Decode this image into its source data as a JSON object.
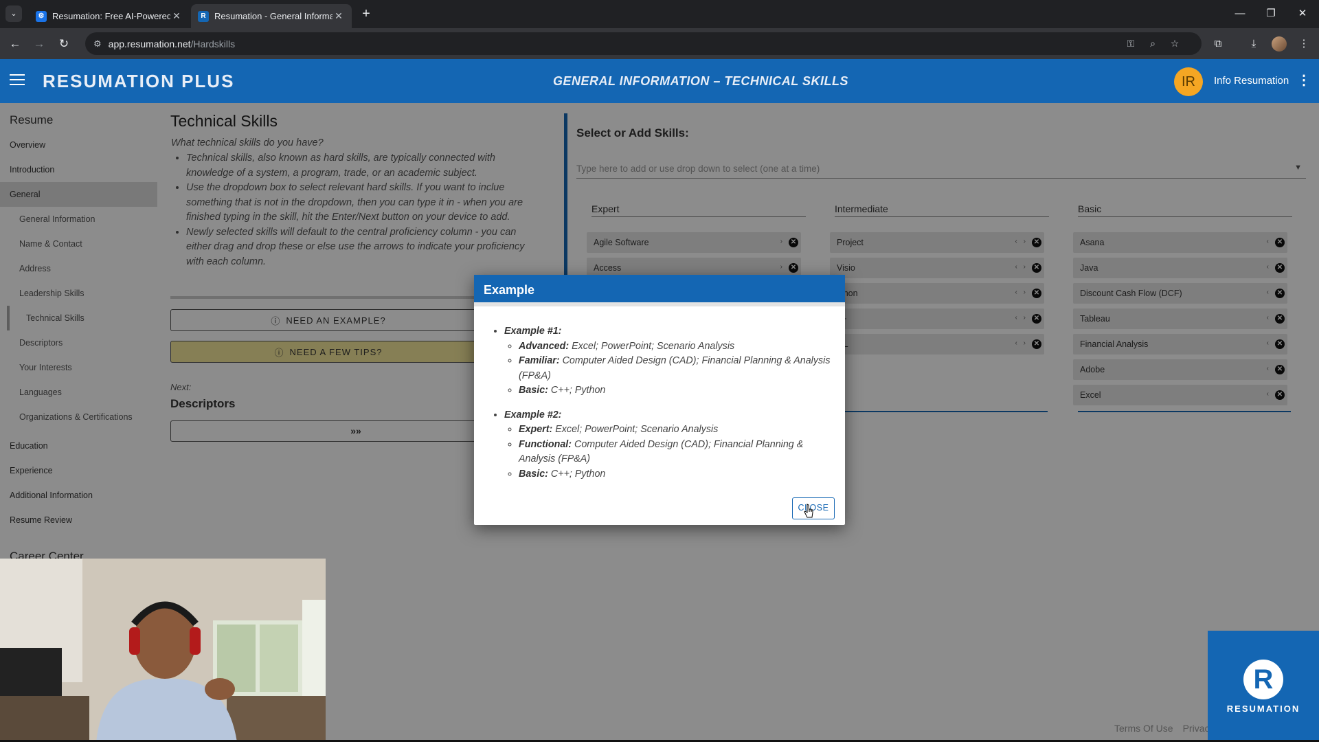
{
  "browser": {
    "tabs": [
      {
        "title": "Resumation: Free AI-Powered R",
        "active": false
      },
      {
        "title": "Resumation - General Informat",
        "active": true
      }
    ],
    "url_host": "app.resumation.net",
    "url_path": "/Hardskills"
  },
  "header": {
    "brand": "RESUMATION PLUS",
    "title": "GENERAL INFORMATION – TECHNICAL SKILLS",
    "avatar_initials": "IR",
    "user_name": "Info Resumation"
  },
  "sidebar": {
    "section_resume": "Resume",
    "items": [
      {
        "label": "Overview"
      },
      {
        "label": "Introduction"
      },
      {
        "label": "General"
      },
      {
        "label": "General Information"
      },
      {
        "label": "Name & Contact"
      },
      {
        "label": "Address"
      },
      {
        "label": "Leadership Skills"
      },
      {
        "label": "Technical Skills"
      },
      {
        "label": "Descriptors"
      },
      {
        "label": "Your Interests"
      },
      {
        "label": "Languages"
      },
      {
        "label": "Organizations & Certifications"
      },
      {
        "label": "Education"
      },
      {
        "label": "Experience"
      },
      {
        "label": "Additional Information"
      },
      {
        "label": "Resume Review"
      }
    ],
    "section_career": "Career Center"
  },
  "main": {
    "title": "Technical Skills",
    "question": "What technical skills do you have?",
    "bullets": [
      "Technical skills, also known as hard skills, are typically connected with knowledge of a system, a program, trade, or an academic subject.",
      "Use the dropdown box to select relevant hard skills. If you want to inclue something that is not in the dropdown, then you can type it in - when you are finished typing in the skill, hit the Enter/Next button on your device to add.",
      "Newly selected skills will default to the central proficiency column - you can either drag and drop these or else use the arrows to indicate your proficiency with each column."
    ],
    "example_button": "NEED AN EXAMPLE?",
    "tips_button": "NEED A FEW TIPS?",
    "next_label": "Next:",
    "next_title": "Descriptors",
    "next_button": "»»"
  },
  "skills": {
    "title": "Select or Add Skills:",
    "input_placeholder": "Type here to add or use drop down to select (one at a time)",
    "columns": [
      {
        "name": "Expert",
        "items": [
          "Agile Software",
          "Access"
        ]
      },
      {
        "name": "Intermediate",
        "items": [
          "Project",
          "Visio",
          "ython",
          "++",
          "QL"
        ]
      },
      {
        "name": "Basic",
        "items": [
          "Asana",
          "Java",
          "Discount Cash Flow (DCF)",
          "Tableau",
          "Financial Analysis",
          "Adobe",
          "Excel"
        ]
      }
    ]
  },
  "modal": {
    "title": "Example",
    "examples": [
      {
        "heading": "Example #1:",
        "lines": [
          {
            "level": "Advanced:",
            "text": "Excel; PowerPoint; Scenario Analysis"
          },
          {
            "level": "Familiar:",
            "text": "Computer Aided Design (CAD); Financial Planning & Analysis (FP&A)"
          },
          {
            "level": "Basic:",
            "text": "C++; Python"
          }
        ]
      },
      {
        "heading": "Example #2:",
        "lines": [
          {
            "level": "Expert:",
            "text": "Excel; PowerPoint; Scenario Analysis"
          },
          {
            "level": "Functional:",
            "text": "Computer Aided Design (CAD); Financial Planning & Analysis (FP&A)"
          },
          {
            "level": "Basic:",
            "text": "C++; Python"
          }
        ]
      }
    ],
    "close_label": "CLOSE"
  },
  "footer": {
    "terms": "Terms Of Use",
    "privacy": "Privac"
  },
  "logo": {
    "letter": "R",
    "text": "RESUMATION"
  },
  "colors": {
    "brand_blue": "#1466b3",
    "tips_yellow": "#f4e79c",
    "avatar_orange": "#f5a623"
  }
}
